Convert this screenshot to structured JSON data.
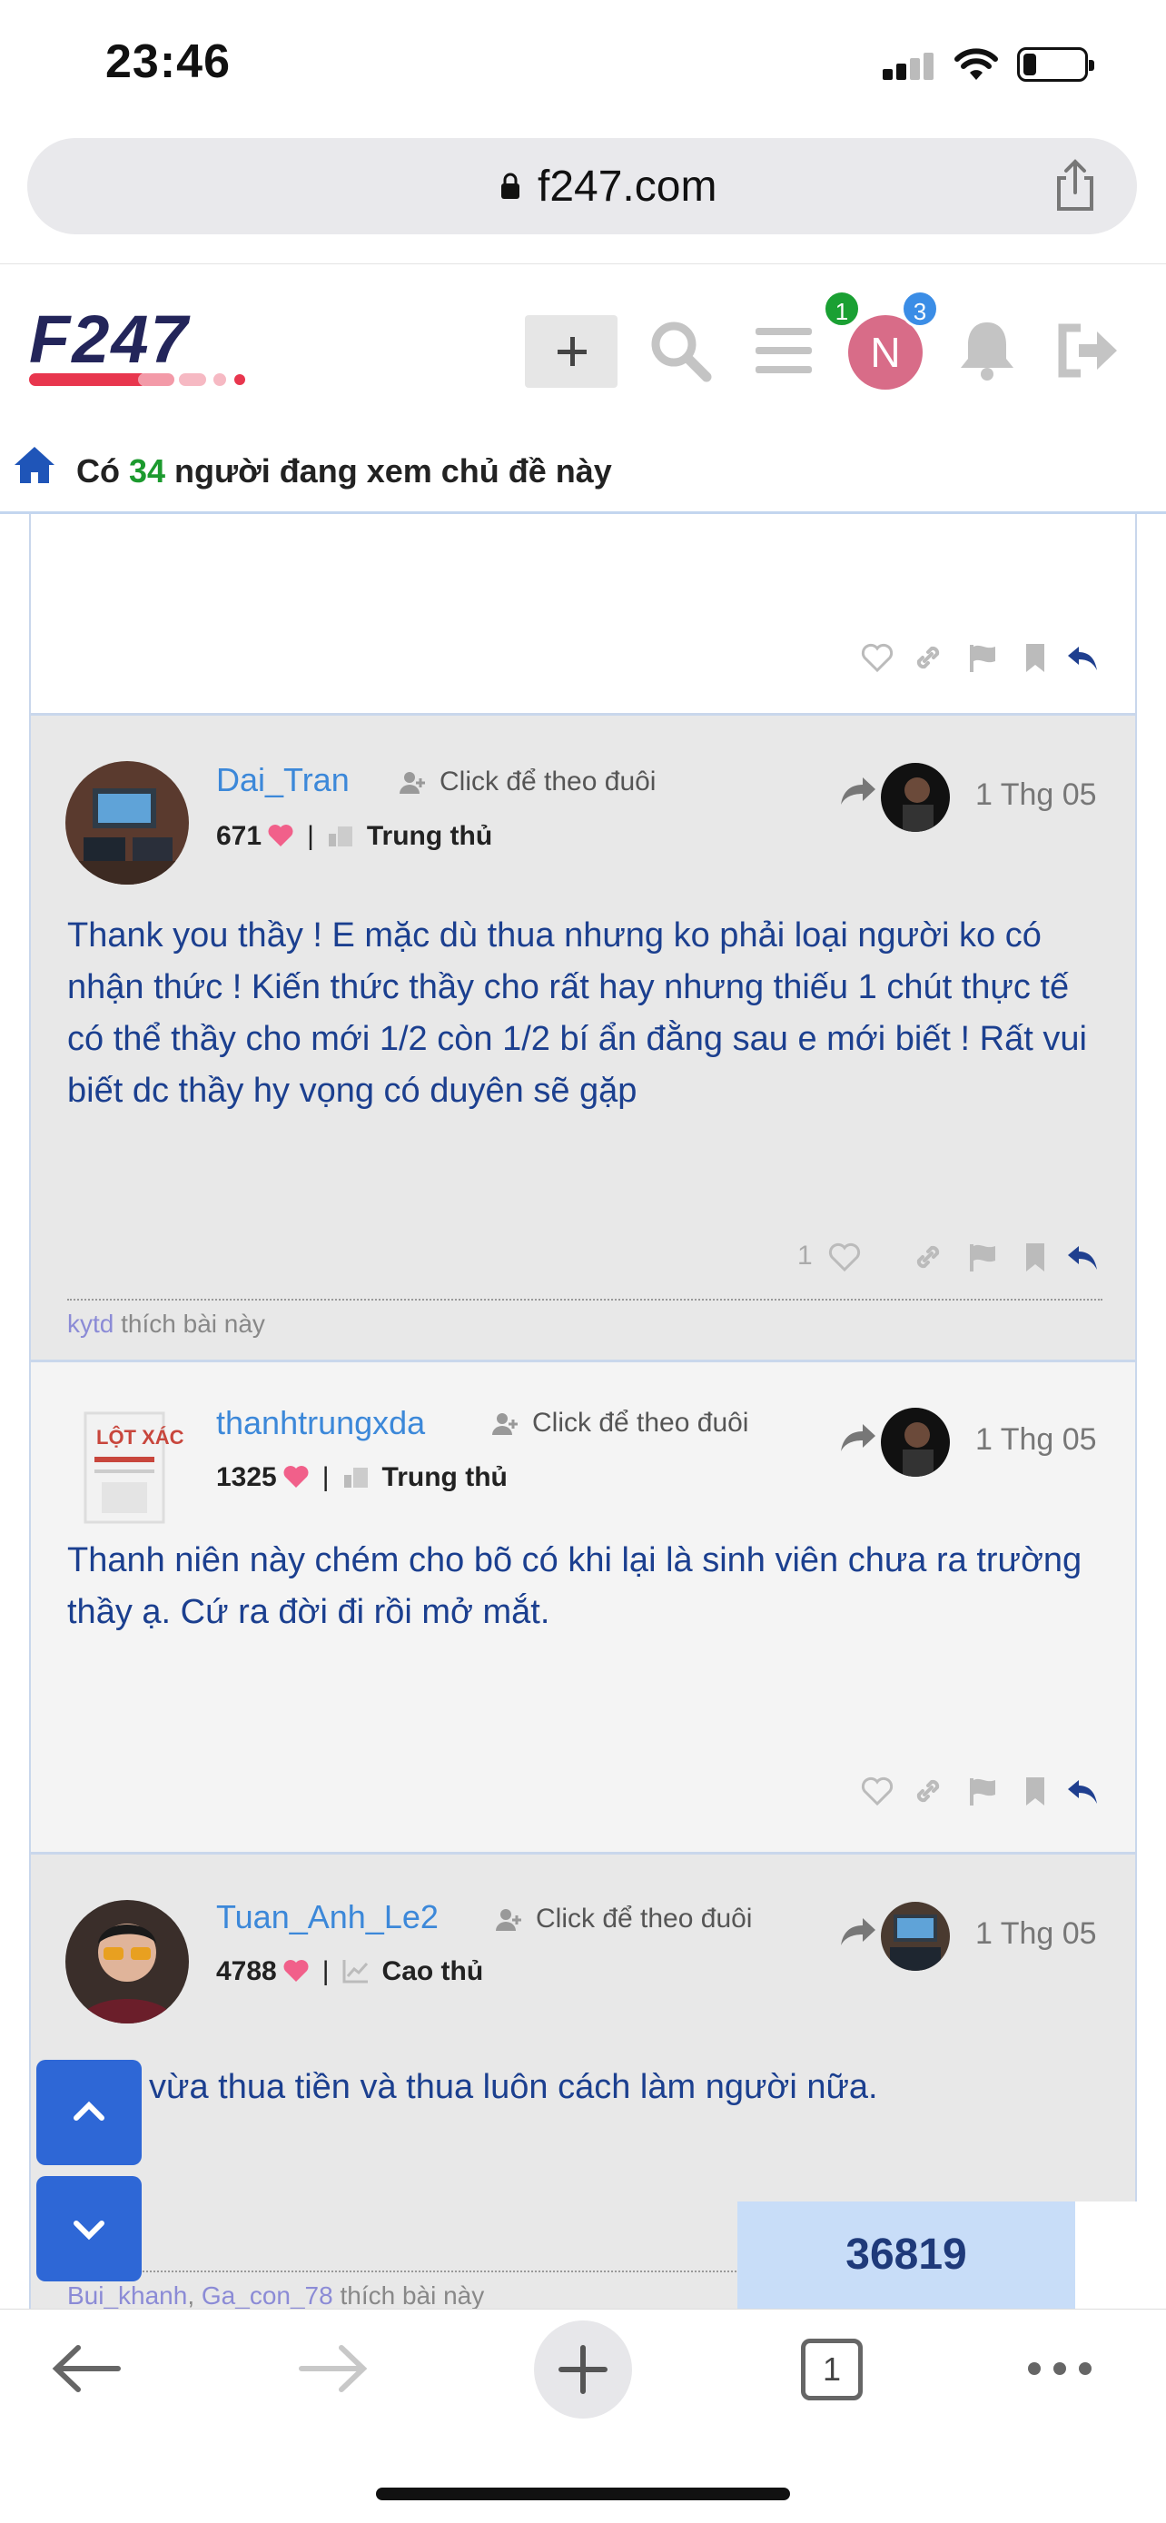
{
  "status_bar": {
    "time": "23:46"
  },
  "browser": {
    "url": "f247.com",
    "tab_count": "1"
  },
  "site": {
    "logo_text": "F247",
    "notification_badge_1": "1",
    "notification_badge_2": "3",
    "avatar_letter": "N",
    "viewers": {
      "prefix": "Có",
      "count": "34",
      "suffix": "người đang xem chủ đề này"
    }
  },
  "posts": [
    {
      "author": "Dai_Tran",
      "follow_label": "Click để theo đuôi",
      "score": "671",
      "rank": "Trung thủ",
      "date": "1 Thg 05",
      "body": "Thank you thầy ! E mặc dù thua nhưng ko phải loại người ko có nhận thức ! Kiến thức thầy cho rất hay nhưng thiếu 1 chút thực tế có thể thầy cho mới 1/2 còn 1/2 bí ẩn đằng sau e mới biết ! Rất vui biết dc thầy hy vọng có duyên sẽ gặp",
      "like_count": "1",
      "liked_by": [
        "kytd"
      ],
      "liked_suffix": "thích bài này"
    },
    {
      "author": "thanhtrungxda",
      "follow_label": "Click để theo đuôi",
      "score": "1325",
      "rank": "Trung thủ",
      "date": "1 Thg 05",
      "body": "Thanh niên này chém cho bõ có khi lại là sinh viên chưa ra trường thầy ạ. Cứ ra đời đi rồi mở mắt."
    },
    {
      "author": "Tuan_Anh_Le2",
      "follow_label": "Click để theo đuôi",
      "score": "4788",
      "rank": "Cao thủ",
      "date": "1 Thg 05",
      "body": "vừa thua tiền và thua luôn cách làm người nữa.",
      "liked_by": [
        "Bui_khanh",
        "Ga_con_78"
      ],
      "liked_separator": ",",
      "liked_suffix": "thích bài này"
    }
  ],
  "counter": "36819",
  "colors": {
    "accent": "#3c88d9",
    "post_text": "#1b3f8f",
    "viewer_count": "#1c9a2e",
    "float_button": "#2e67d6"
  }
}
